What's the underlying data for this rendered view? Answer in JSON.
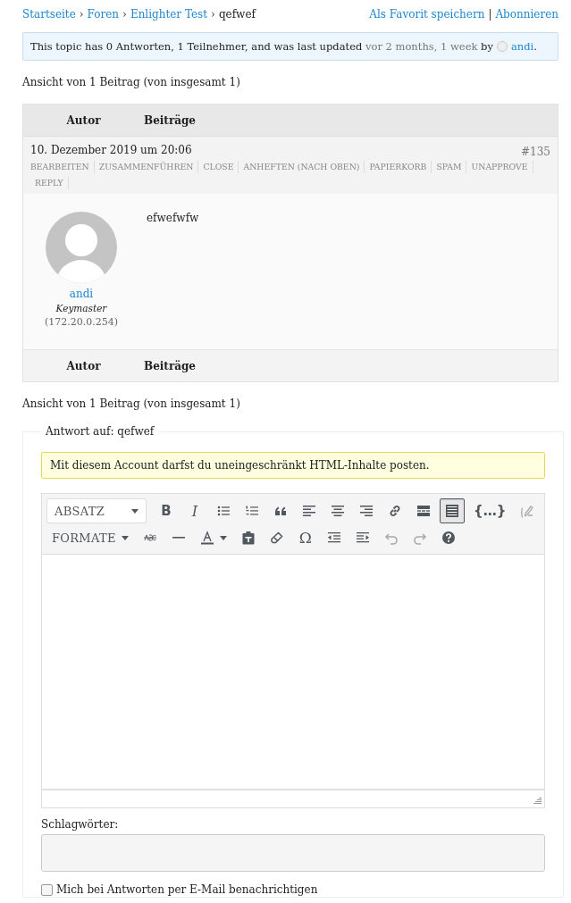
{
  "breadcrumb": [
    {
      "label": "Startseite",
      "link": true
    },
    {
      "label": "Foren",
      "link": true,
      "separator": "›"
    },
    {
      "label": "Enlighter Test",
      "link": true,
      "separator": "›"
    },
    {
      "label": "qefwef",
      "link": false,
      "separator": "›"
    }
  ],
  "topic_actions": [
    {
      "label": "Als Favorit speichern"
    },
    {
      "label": "Abonnieren",
      "separator": "|"
    }
  ],
  "topic_info": {
    "text": "This topic has 0 Antworten, 1 Teilnehmer, and was last updated",
    "freshness": "vor 2 months, 1 week",
    "by": "by",
    "author": "andi",
    "end": "."
  },
  "pagination_top": "Ansicht von 1 Beitrag (von insgesamt 1)",
  "table_header": [
    "Autor",
    "Beiträge"
  ],
  "post": {
    "date": "10. Dezember 2019 um 20:06",
    "number": "#135",
    "admin_links": [
      "BEARBEITEN",
      "ZUSAMMENFÜHREN",
      "CLOSE",
      "ANHEFTEN (NACH OBEN)",
      "PAPIERKORB",
      "SPAM",
      "UNAPPROVE",
      "REPLY"
    ],
    "author": "andi",
    "role": "Keymaster",
    "ip": "(172.20.0.254)",
    "content": "efwefwfw"
  },
  "table_footer": [
    "Autor",
    "Beiträge"
  ],
  "pagination_bottom": "Ansicht von 1 Beitrag (von insgesamt 1)",
  "reply_form": {
    "legend": "Antwort auf: qefwef",
    "notice": "Mit diesem Account darfst du uneingeschränkt HTML-Inhalte posten.",
    "toolbar": [
      [
        {
          "kind": "dropdown",
          "label": "ABSATZ",
          "boxed": true,
          "pressed": false,
          "disabled": false
        },
        {
          "kind": "bold",
          "label": "B",
          "pressed": false,
          "disabled": false
        },
        {
          "kind": "italic",
          "label": "I",
          "pressed": false,
          "disabled": false
        },
        {
          "kind": "bullist",
          "pressed": false,
          "disabled": false
        },
        {
          "kind": "numlist",
          "pressed": false,
          "disabled": false
        },
        {
          "kind": "blockquote",
          "pressed": false,
          "disabled": false
        },
        {
          "kind": "alignleft",
          "pressed": false,
          "disabled": false
        },
        {
          "kind": "aligncenter",
          "pressed": false,
          "disabled": false
        },
        {
          "kind": "alignright",
          "pressed": false,
          "disabled": false
        },
        {
          "kind": "link",
          "pressed": false,
          "disabled": false
        },
        {
          "kind": "more",
          "pressed": false,
          "disabled": false
        },
        {
          "kind": "kitchensink",
          "pressed": true,
          "disabled": false
        },
        {
          "kind": "code",
          "label": "{…}",
          "pressed": false,
          "disabled": false
        },
        {
          "kind": "pencil",
          "pressed": false,
          "disabled": true
        }
      ],
      [
        {
          "kind": "dropdown",
          "label": "FORMATE",
          "boxed": false,
          "pressed": false,
          "disabled": false
        },
        {
          "kind": "strikethrough",
          "pressed": false,
          "disabled": false
        },
        {
          "kind": "hr",
          "pressed": false,
          "disabled": false
        },
        {
          "kind": "textcolor",
          "pressed": false,
          "disabled": false
        },
        {
          "kind": "paste",
          "pressed": false,
          "disabled": false
        },
        {
          "kind": "eraser",
          "pressed": false,
          "disabled": false
        },
        {
          "kind": "symbol",
          "label": "Ω",
          "pressed": false,
          "disabled": false
        },
        {
          "kind": "outdent",
          "pressed": false,
          "disabled": false
        },
        {
          "kind": "indent",
          "pressed": false,
          "disabled": false
        },
        {
          "kind": "undo",
          "pressed": false,
          "disabled": true
        },
        {
          "kind": "redo",
          "pressed": false,
          "disabled": true
        },
        {
          "kind": "help",
          "pressed": false,
          "disabled": false
        }
      ]
    ],
    "tags_label": "Schlagwörter:",
    "notify": {
      "label": "Mich bei Antworten per E-Mail benachrichtigen",
      "checked": false
    }
  }
}
